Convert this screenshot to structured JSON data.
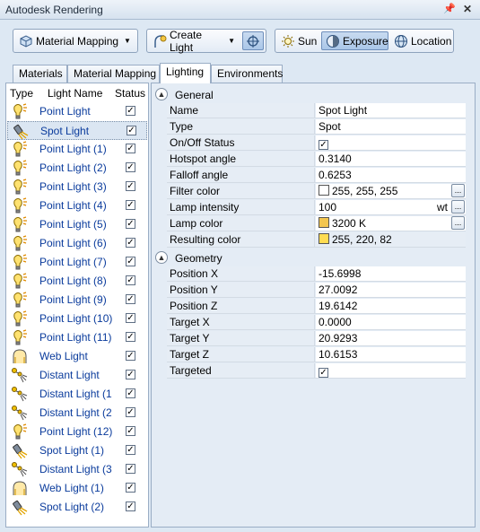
{
  "window": {
    "title": "Autodesk Rendering"
  },
  "toolbar": {
    "material_mapping": "Material Mapping",
    "create_light": "Create Light",
    "sun": "Sun",
    "exposure": "Exposure",
    "location": "Location"
  },
  "tabs": [
    "Materials",
    "Material Mapping",
    "Lighting",
    "Environments"
  ],
  "light_list": {
    "headers": {
      "type": "Type",
      "name": "Light Name",
      "status": "Status"
    },
    "items": [
      {
        "name": "Point Light",
        "kind": "point"
      },
      {
        "name": "Spot Light",
        "kind": "spot"
      },
      {
        "name": "Point Light (1)",
        "kind": "point"
      },
      {
        "name": "Point Light (2)",
        "kind": "point"
      },
      {
        "name": "Point Light (3)",
        "kind": "point"
      },
      {
        "name": "Point Light (4)",
        "kind": "point"
      },
      {
        "name": "Point Light (5)",
        "kind": "point"
      },
      {
        "name": "Point Light (6)",
        "kind": "point"
      },
      {
        "name": "Point Light (7)",
        "kind": "point"
      },
      {
        "name": "Point Light (8)",
        "kind": "point"
      },
      {
        "name": "Point Light (9)",
        "kind": "point"
      },
      {
        "name": "Point Light (10)",
        "kind": "point"
      },
      {
        "name": "Point Light (11)",
        "kind": "point"
      },
      {
        "name": "Web Light",
        "kind": "web"
      },
      {
        "name": "Distant Light",
        "kind": "distant"
      },
      {
        "name": "Distant Light (1",
        "kind": "distant"
      },
      {
        "name": "Distant Light (2",
        "kind": "distant"
      },
      {
        "name": "Point Light (12)",
        "kind": "point"
      },
      {
        "name": "Spot Light (1)",
        "kind": "spot"
      },
      {
        "name": "Distant Light (3",
        "kind": "distant"
      },
      {
        "name": "Web Light (1)",
        "kind": "web"
      },
      {
        "name": "Spot Light (2)",
        "kind": "spot"
      }
    ]
  },
  "general": {
    "title": "General",
    "rows": [
      {
        "label": "Name",
        "value": "Spot Light"
      },
      {
        "label": "Type",
        "value": "Spot"
      },
      {
        "label": "On/Off Status",
        "value": "",
        "check": true
      },
      {
        "label": "Hotspot angle",
        "value": "0.3140"
      },
      {
        "label": "Falloff angle",
        "value": "0.6253"
      },
      {
        "label": "Filter color",
        "value": "255, 255, 255",
        "swatch": "#ffffff",
        "button": "..."
      },
      {
        "label": "Lamp intensity",
        "value": "100",
        "unit": "wt",
        "button": "..."
      },
      {
        "label": "Lamp color",
        "value": "3200 K",
        "swatch": "#f3c64f",
        "button": "..."
      },
      {
        "label": "Resulting color",
        "value": "255, 220, 82",
        "swatch": "#ffdc52"
      }
    ]
  },
  "geometry": {
    "title": "Geometry",
    "rows": [
      {
        "label": "Position X",
        "value": "-15.6998"
      },
      {
        "label": "Position Y",
        "value": "27.0092"
      },
      {
        "label": "Position Z",
        "value": "19.6142"
      },
      {
        "label": "Target X",
        "value": "0.0000"
      },
      {
        "label": "Target Y",
        "value": "20.9293"
      },
      {
        "label": "Target Z",
        "value": "10.6153"
      },
      {
        "label": "Targeted",
        "value": "",
        "check": true
      }
    ]
  }
}
